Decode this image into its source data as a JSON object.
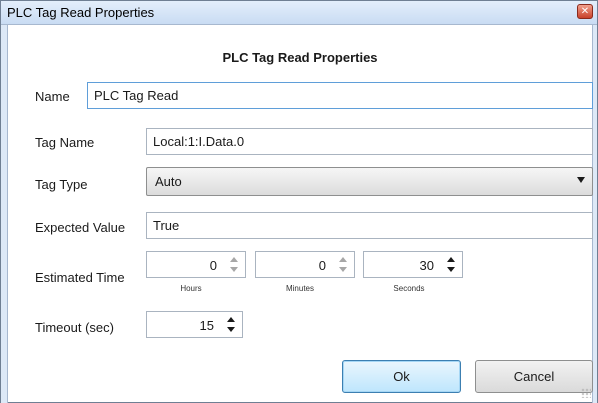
{
  "window": {
    "title": "PLC Tag Read Properties",
    "close_icon": "close-icon"
  },
  "form": {
    "heading": "PLC Tag Read Properties",
    "name": {
      "label": "Name",
      "value": "PLC Tag Read"
    },
    "tag_name": {
      "label": "Tag Name",
      "value": "Local:1:I.Data.0"
    },
    "tag_type": {
      "label": "Tag Type",
      "selected": "Auto"
    },
    "expected_value": {
      "label": "Expected Value",
      "value": "True"
    },
    "estimated_time": {
      "label": "Estimated Time",
      "hours": {
        "value": "0",
        "caption": "Hours"
      },
      "minutes": {
        "value": "0",
        "caption": "Minutes"
      },
      "seconds": {
        "value": "30",
        "caption": "Seconds"
      }
    },
    "timeout": {
      "label": "Timeout (sec)",
      "value": "15"
    }
  },
  "buttons": {
    "ok_label": "Ok",
    "cancel_label": "Cancel"
  },
  "colors": {
    "titlebar": "#c9dcf3",
    "focus_border": "#5f9ed9",
    "ok_button": "#bee6fd",
    "close_button": "#c8412a"
  }
}
